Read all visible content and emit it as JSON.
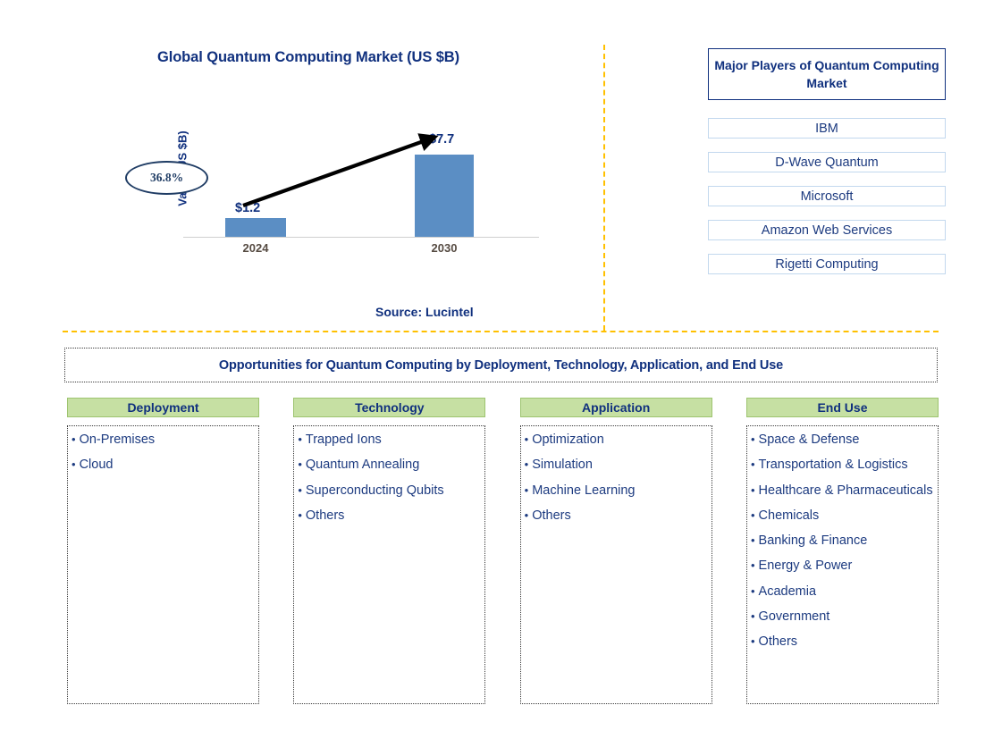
{
  "chart_data": {
    "type": "bar",
    "title": "Global Quantum Computing Market (US $B)",
    "xlabel": "",
    "ylabel": "Value (US $B)",
    "categories": [
      "2024",
      "2030"
    ],
    "values": [
      1.2,
      7.7
    ],
    "value_labels": [
      "$1.2",
      "$7.7"
    ],
    "ylim": [
      0,
      8.8
    ],
    "grid": false,
    "legend": "none",
    "bar_color": "#5b8ec4",
    "annotation": {
      "label": "36.8%",
      "meaning": "CAGR",
      "style": "ellipse-with-arrow",
      "arrow_color": "#000000",
      "ellipse_border_color": "#1f3c64"
    },
    "source": "Source: Lucintel"
  },
  "chart_panel": {
    "title": "Global Quantum Computing Market (US $B)",
    "y_axis_label": "Value (US $B)",
    "tick_labels": [
      "2024",
      "2030"
    ],
    "bar_values": [
      "$1.2",
      "$7.7"
    ],
    "cagr_label": "36.8%",
    "source": "Source: Lucintel"
  },
  "players_panel": {
    "header": "Major Players of Quantum Computing Market",
    "items": [
      "IBM",
      "D-Wave Quantum",
      "Microsoft",
      "Amazon Web Services",
      "Rigetti Computing"
    ]
  },
  "opportunities": {
    "header": "Opportunities for Quantum Computing by Deployment, Technology, Application, and End Use",
    "columns": [
      {
        "title": "Deployment",
        "items": [
          "On-Premises",
          "Cloud"
        ]
      },
      {
        "title": "Technology",
        "items": [
          "Trapped Ions",
          "Quantum Annealing",
          "Superconducting Qubits",
          "Others"
        ]
      },
      {
        "title": "Application",
        "items": [
          "Optimization",
          "Simulation",
          "Machine Learning",
          "Others"
        ]
      },
      {
        "title": "End Use",
        "items": [
          "Space & Defense",
          "Transportation & Logistics",
          "Healthcare & Pharmaceuticals",
          "Chemicals",
          "Banking & Finance",
          "Energy & Power",
          "Academia",
          "Government",
          "Others"
        ]
      }
    ]
  },
  "theme": {
    "navy": "#10307e",
    "bar_blue": "#5b8ec4",
    "header_green": "#c6e0a3",
    "divider_gold": "#ffc000",
    "text_blue": "#1d3b80"
  }
}
